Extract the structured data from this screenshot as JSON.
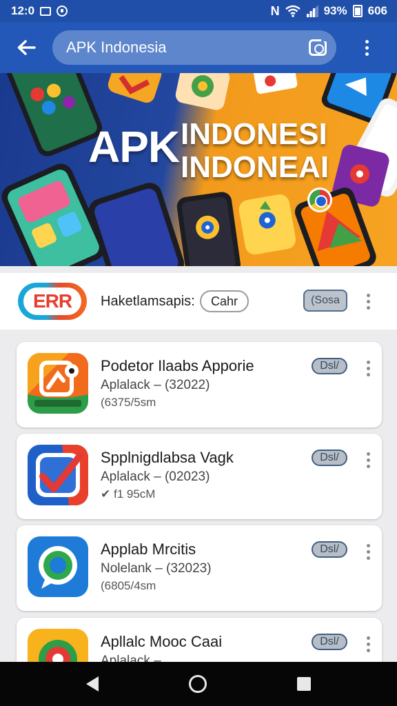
{
  "status_bar": {
    "time": "12:0",
    "battery_text": "93%",
    "right_text": "606"
  },
  "app_bar": {
    "back_icon": "arrow-left-icon",
    "search_text": "APK Indonesia",
    "camera_icon": "camera-icon",
    "menu_icon": "more-vert-icon"
  },
  "banner": {
    "title": "APK",
    "subtitle_line1": "INDONESI",
    "subtitle_line2": "INDONEAI"
  },
  "featured": {
    "logo_text": "ERR",
    "label": "Haketlamsapis:",
    "chip": "Cahr",
    "button": "(Sosa"
  },
  "apps": [
    {
      "title": "Podetor Ilaabs Apporie",
      "developer": "Aplalack – (32022)",
      "size": "(6375/5sm",
      "button": "Dsl/"
    },
    {
      "title": "Spplnigdlabsa Vagk",
      "developer": "Aplalack – (02023)",
      "size": "✔ f1 95cM",
      "button": "Dsl/"
    },
    {
      "title": "Applab Mrcitis",
      "developer": "Nolelank – (32023)",
      "size": "(6805/4sm",
      "button": "Dsl/"
    },
    {
      "title": "Apllalc Mooc Caai",
      "developer": "Aplalack –",
      "size": "",
      "button": "Dsl/"
    }
  ],
  "colors": {
    "app_bar": "#2358b8",
    "status_bar": "#1f4fa8",
    "banner_blue": "#1a3a8f",
    "banner_orange": "#f29a1c"
  }
}
